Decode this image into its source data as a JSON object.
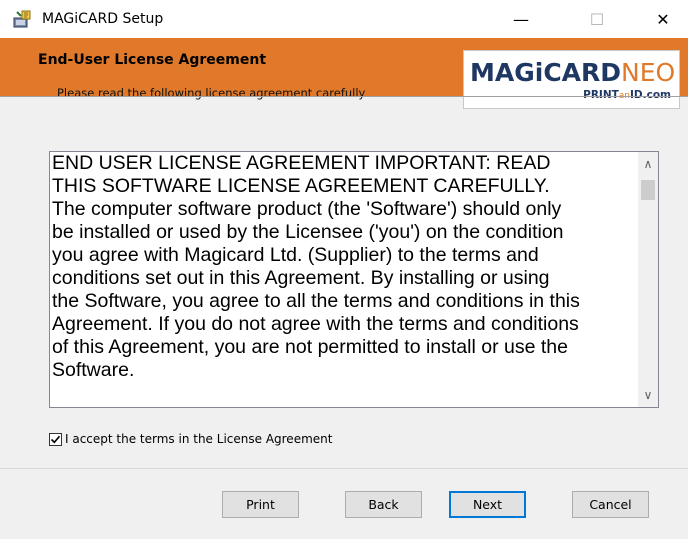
{
  "window": {
    "title": "MAGiCARD Setup",
    "minimize_glyph": "—",
    "maximize_glyph": "☐",
    "close_glyph": "✕"
  },
  "header": {
    "title": "End-User License Agreement",
    "subtitle": "Please read the following license agreement carefully",
    "logo": {
      "main_part1": "MAGiCARD",
      "main_part2": "NEO",
      "sub_part1": "PRINT",
      "sub_part2": "an",
      "sub_part3": "ID.com"
    }
  },
  "license": {
    "text": "END USER LICENSE AGREEMENT IMPORTANT: READ\nTHIS SOFTWARE LICENSE AGREEMENT CAREFULLY.\nThe computer software product (the 'Software') should only\nbe installed or used by the Licensee ('you') on the condition\nyou agree with Magicard Ltd. (Supplier) to the terms and\nconditions set out in this Agreement. By installing or using\nthe Software, you agree to all the terms and conditions in this\nAgreement. If you do not agree with the terms and conditions\nof this Agreement, you are not permitted to install or use the\nSoftware.",
    "scroll_up_glyph": "∧",
    "scroll_down_glyph": "∨"
  },
  "accept": {
    "label": "I accept the terms in the License Agreement",
    "checked": true
  },
  "buttons": {
    "print": "Print",
    "back": "Back",
    "next": "Next",
    "cancel": "Cancel"
  },
  "colors": {
    "header_bg": "#e07a2a",
    "logo_navy": "#1e3763",
    "focus_blue": "#0078d7"
  }
}
